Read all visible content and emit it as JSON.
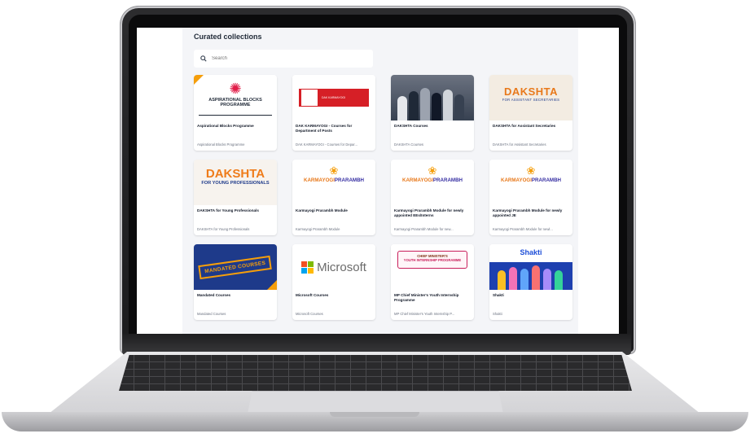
{
  "page": {
    "title": "Curated collections",
    "search_placeholder": "Search"
  },
  "thumbs": {
    "aspirational": "ASPIRATIONAL BLOCKS PROGRAMME",
    "dak": "DAK KARMAYOGI",
    "daksh_big": "DAKSHTA",
    "daksh_sub": "FOR ASSISTANT SECRETARIES",
    "dyp_big": "DAKSHTA",
    "dyp_sub": "FOR YOUNG PROFESSIONALS",
    "kp_a": "KARMAYOGI",
    "kp_b": "PRARAMBH",
    "mandated": "MANDATED COURSES",
    "microsoft": "Microsoft",
    "cm_line1": "CHIEF MINISTER'S",
    "cm_line2": "YOUTH INTERNSHIP PROGRAMME",
    "shakti": "Shakti"
  },
  "cards": [
    {
      "title": "Aspirational Blocks Programme",
      "subtitle": "Aspirational Blocks Programme"
    },
    {
      "title": "DAK KARMAYOGI - Courses for Department of Posts",
      "subtitle": "DAK KARMAYOGI - Courses for Depar..."
    },
    {
      "title": "DAKSHTA Courses",
      "subtitle": "DAKSHTA Courses"
    },
    {
      "title": "DAKSHTA for Assistant Secretaries",
      "subtitle": "DAKSHTA for Assistant Secretaries"
    },
    {
      "title": "DAKSHTA for Young Professionals",
      "subtitle": "DAKSHTA for Young Professionals"
    },
    {
      "title": "Karmayogi Prarambh Module",
      "subtitle": "Karmayogi Prarambh Module"
    },
    {
      "title": "Karmayogi Prarambh Module for newly appointed EEs/Interns",
      "subtitle": "Karmayogi Prarambh Module for new..."
    },
    {
      "title": "Karmayogi Prarambh Module for newly appointed JE",
      "subtitle": "Karmayogi Prarambh Module for newl..."
    },
    {
      "title": "Mandated Courses",
      "subtitle": "Mandated Courses"
    },
    {
      "title": "Microsoft Courses",
      "subtitle": "Microsoft Courses"
    },
    {
      "title": "MP Chief Minister's Youth Internship Programme",
      "subtitle": "MP Chief Minister's Youth Internship P..."
    },
    {
      "title": "Shakti",
      "subtitle": "Shakti"
    }
  ],
  "colors": {
    "accent_orange": "#f59e0b",
    "page_bg": "#f4f5f8",
    "brand_blue": "#1e3a8a"
  }
}
